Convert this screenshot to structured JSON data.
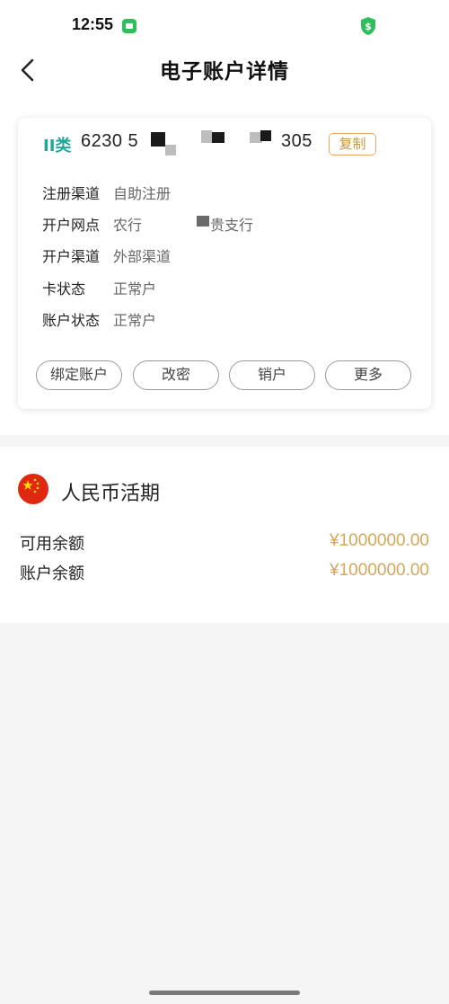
{
  "status_bar": {
    "time": "12:55"
  },
  "nav": {
    "title": "电子账户详情"
  },
  "card": {
    "type_badge": "II类",
    "account_prefix": "6230 5",
    "account_suffix": "305",
    "copy_label": "复制",
    "rows": [
      {
        "label": "注册渠道",
        "value": "自助注册"
      },
      {
        "label": "开户网点",
        "value": "农行",
        "value_suffix": "贵支行"
      },
      {
        "label": "开户渠道",
        "value": "外部渠道"
      },
      {
        "label": "卡状态",
        "value": "正常户"
      },
      {
        "label": "账户状态",
        "value": "正常户"
      }
    ],
    "actions": [
      "绑定账户",
      "改密",
      "销户",
      "更多"
    ]
  },
  "currency": {
    "name": "人民币活期",
    "balances": [
      {
        "label": "可用余额",
        "value": "¥1000000.00"
      },
      {
        "label": "账户余额",
        "value": "¥1000000.00"
      }
    ]
  },
  "colors": {
    "accent_teal": "#1fa89a",
    "gold": "#d4a85a",
    "flag_red": "#de2910",
    "flag_star": "#ffde00"
  },
  "icons": {
    "status_msg": "message-icon",
    "status_shield": "shield-dollar-icon",
    "back": "chevron-left-icon",
    "flag": "china-flag-icon"
  }
}
